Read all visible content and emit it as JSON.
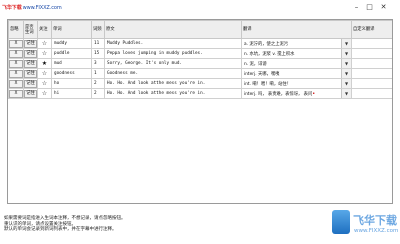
{
  "logo": {
    "text": "飞华下载",
    "url": "www.FIXXZ.com"
  },
  "window_controls": {
    "minimize": "–",
    "maximize": "□",
    "close": "✕"
  },
  "columns": [
    "忽略",
    "是否生词",
    "关注",
    "单词",
    "词频",
    "原文",
    "翻译",
    "自定义翻译"
  ],
  "rows": [
    {
      "ignore": "X",
      "status": "记住",
      "star": "☆",
      "word": "muddy",
      "freq": "11",
      "source": "Muddy Puddles.",
      "trans_prefix": "a.",
      "translation": "泥泞的，使之上泥污",
      "dot": "",
      "custom": ""
    },
    {
      "ignore": "X",
      "status": "记住",
      "star": "☆",
      "word": "puddle",
      "freq": "15",
      "source": "Peppa loves jumping in muddy puddles.",
      "trans_prefix": "n.",
      "translation": "水坑，泥浆 v. 搅上积水",
      "dot": "",
      "custom": ""
    },
    {
      "ignore": "X",
      "status": "记住",
      "star": "★",
      "word": "mud",
      "freq": "3",
      "source": "Sorry, George. It's only mud.",
      "trans_prefix": "n.",
      "translation": "泥，诽谤",
      "dot": "",
      "custom": ""
    },
    {
      "ignore": "X",
      "status": "记住",
      "star": "☆",
      "word": "goodness",
      "freq": "1",
      "source": "Goodness me.",
      "trans_prefix": "interj.",
      "translation": "天哪，嘿咦",
      "dot": "",
      "custom": ""
    },
    {
      "ignore": "X",
      "status": "记住",
      "star": "☆",
      "word": "ho",
      "freq": "2",
      "source": "Ho. Ho. And look atthe mess you're in.",
      "trans_prefix": "int.",
      "translation": "嗬！喂！嗬，站住！",
      "dot": "",
      "custom": ""
    },
    {
      "ignore": "X",
      "status": "记住",
      "star": "☆",
      "word": "hi",
      "freq": "2",
      "source": "Ho. Ho. And look atthe mess you're in.",
      "trans_prefix": "interj.",
      "translation": "吗， 表责难，表惊讶， 表问",
      "dot": "•",
      "custom": ""
    }
  ],
  "notes": [
    "如果需要词是指进入生词本注释，不想记录，请点忽略按钮。",
    "重认识的单词，请点设置关注按钮。",
    "默认的单词会记录到新词列表中，并在字幕中进行注释。"
  ],
  "watermark": {
    "title": "飞华下载",
    "sub": "www.FIXXZ.com"
  }
}
